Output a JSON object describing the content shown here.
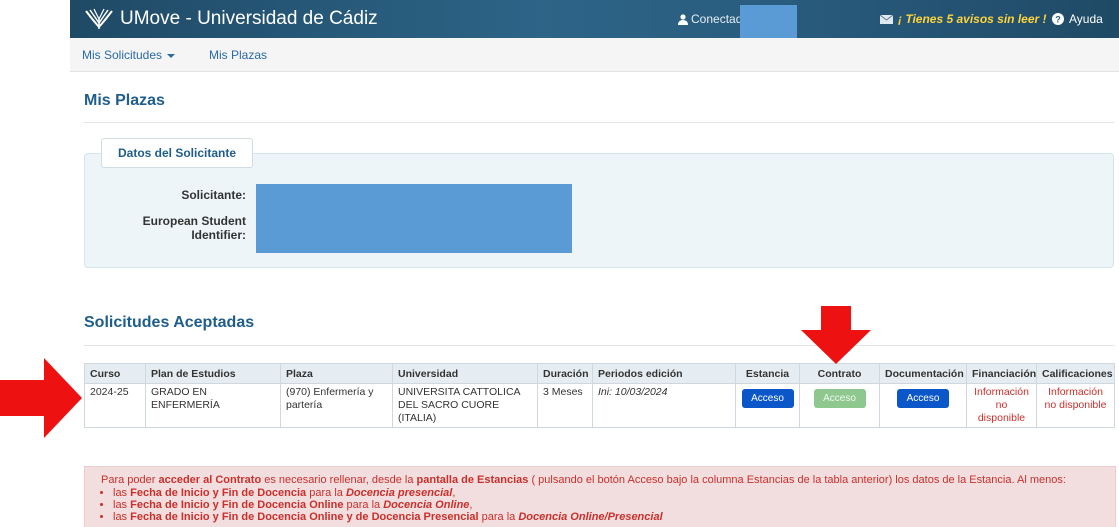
{
  "header": {
    "app_title": "UMove - Universidad de Cádiz",
    "connected_as": "Conectado como:",
    "unread_notice": "¡ Tienes 5 avisos sin leer !",
    "help": "Ayuda"
  },
  "nav": {
    "items": [
      {
        "label": "Mis Solicitudes"
      },
      {
        "label": "Mis Plazas"
      }
    ]
  },
  "page_title": "Mis Plazas",
  "applicant": {
    "legend": "Datos del Solicitante",
    "solicitante_label": "Solicitante:",
    "esi_label_line1": "European Student",
    "esi_label_line2": "Identifier:"
  },
  "accepted": {
    "title": "Solicitudes Aceptadas",
    "columns": [
      "Curso",
      "Plan de Estudios",
      "Plaza",
      "Universidad",
      "Duración",
      "Periodos edición",
      "Estancia",
      "Contrato",
      "Documentación",
      "Financiación",
      "Calificaciones"
    ],
    "row": {
      "curso": "2024-25",
      "plan": "GRADO EN ENFERMERÍA",
      "plaza": "(970) Enfermería y partería",
      "universidad": "UNIVERSITA CATTOLICA DEL SACRO CUORE (ITALIA)",
      "duracion": "3 Meses",
      "periodos": "Ini: 10/03/2024",
      "estancia_btn": "Acceso",
      "contrato_btn": "Acceso",
      "documentacion_btn": "Acceso",
      "financiacion": "Información no disponible",
      "calificaciones": "Información no disponible"
    }
  },
  "alert": {
    "p1": "Para poder ",
    "p1b": "acceder al Contrato",
    "p2": " es necesario rellenar, desde la ",
    "p2b": "pantalla de Estancias",
    "p3": " ( pulsando el botón Acceso bajo la columna Estancias de la tabla anterior) los datos de la Estancia. Al menos:",
    "li1a": "las ",
    "li1b": "Fecha de Inicio y Fin de Docencia",
    "li1c": " para la ",
    "li1d": "Docencia presencial",
    "li1e": ",",
    "li2a": "las ",
    "li2b": "Fecha de Inicio y Fin de Docencia Online",
    "li2c": " para la ",
    "li2d": "Docencia Online",
    "li2e": ",",
    "li3a": "las ",
    "li3b": "Fecha de Inicio y Fin de Docencia Online y de Docencia Presencial",
    "li3c": " para la ",
    "li3d": "Docencia Online/Presencial"
  },
  "colors": {
    "header_bg": "#2a5d80",
    "notice": "#ffd43b",
    "primary_button": "#0b56c8",
    "disabled_button": "#8fc88f",
    "annotation_arrow": "#ee1111"
  }
}
